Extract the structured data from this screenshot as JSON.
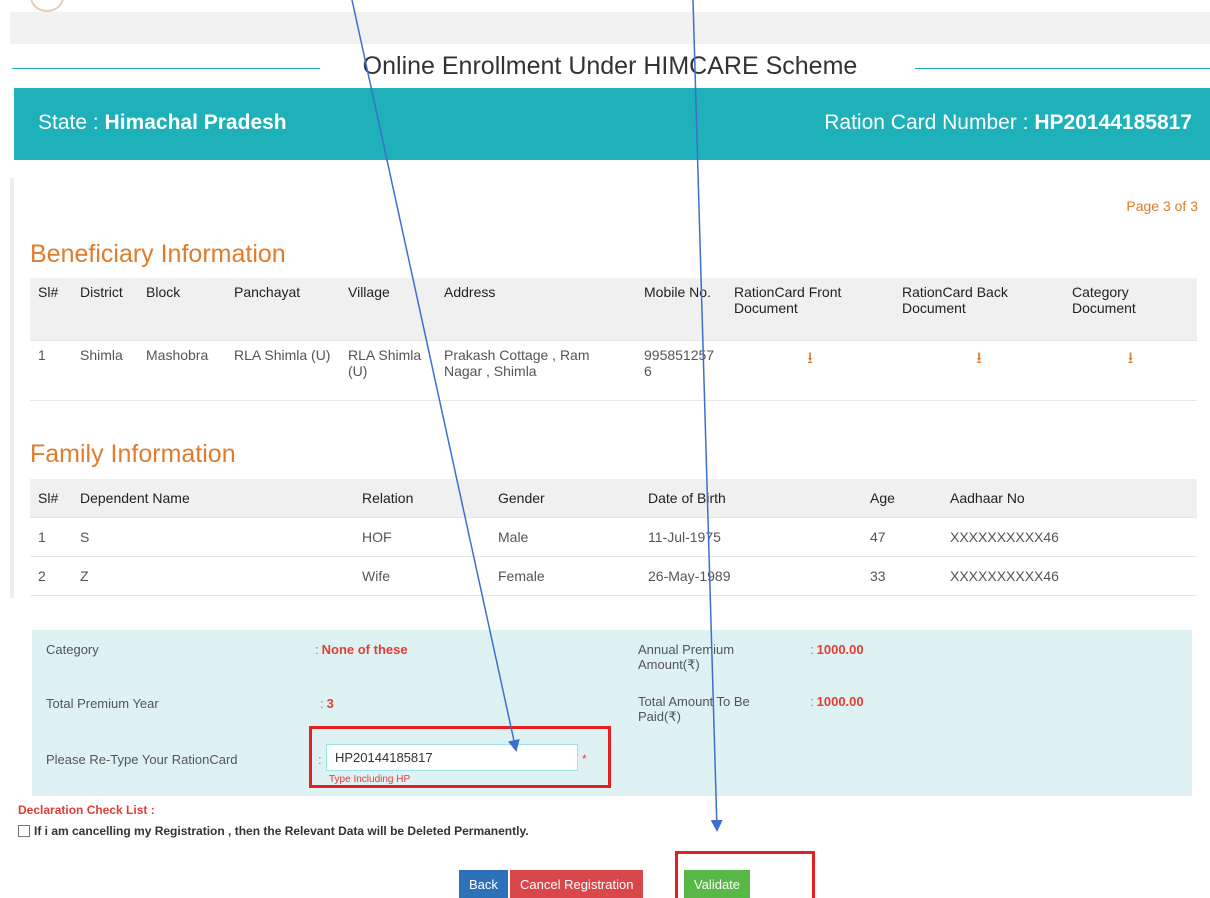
{
  "page": {
    "title": "Online Enrollment Under HIMCARE Scheme",
    "page_indicator": "Page 3 of 3"
  },
  "header": {
    "state_label": "State : ",
    "state_value": "Himachal Pradesh",
    "ration_label": "Ration Card Number : ",
    "ration_value": "HP20144185817"
  },
  "beneficiary": {
    "title": "Beneficiary Information",
    "columns": [
      "Sl#",
      "District",
      "Block",
      "Panchayat",
      "Village",
      "Address",
      "Mobile No.",
      "RationCard Front Document",
      "RationCard Back Document",
      "Category Document"
    ],
    "rows": [
      {
        "sl": "1",
        "district": "Shimla",
        "block": "Mashobra",
        "panchayat": "RLA Shimla (U)",
        "village": "RLA Shimla (U)",
        "address": "Prakash Cottage , Ram Nagar , Shimla",
        "mobile": "9958512576"
      }
    ],
    "download_icon": "download-icon"
  },
  "family": {
    "title": "Family Information",
    "columns": [
      "Sl#",
      "Dependent Name",
      "Relation",
      "Gender",
      "Date of Birth",
      "Age",
      "Aadhaar No"
    ],
    "rows": [
      {
        "sl": "1",
        "name": "S",
        "relation": "HOF",
        "gender": "Male",
        "dob": "11-Jul-1975",
        "age": "47",
        "aadhaar": "XXXXXXXXXX46"
      },
      {
        "sl": "2",
        "name": "Z",
        "relation": "Wife",
        "gender": "Female",
        "dob": "26-May-1989",
        "age": "33",
        "aadhaar": "XXXXXXXXXX46"
      }
    ]
  },
  "summary": {
    "category_label": "Category",
    "category_value": "None of these",
    "annual_premium_label": "Annual Premium Amount(₹)",
    "annual_premium_value": "1000.00",
    "total_years_label": "Total Premium Year",
    "total_years_value": "3",
    "total_amount_label": "Total Amount To Be Paid(₹)",
    "total_amount_value": "1000.00",
    "retype_label": "Please Re-Type Your RationCard",
    "retype_value": "HP20144185817",
    "retype_hint": "Type Including HP",
    "required_mark": "*",
    "colon": ":"
  },
  "declaration": {
    "title": "Declaration Check List :",
    "text": "If i am cancelling my Registration , then the Relevant Data will be Deleted Permanently."
  },
  "buttons": {
    "back": "Back",
    "cancel": "Cancel Registration",
    "validate": "Validate"
  },
  "colors": {
    "teal": "#1eb1ba",
    "orange": "#e07c2b",
    "annotation_red": "#e52020",
    "arrow_blue": "#3d6fd0"
  }
}
